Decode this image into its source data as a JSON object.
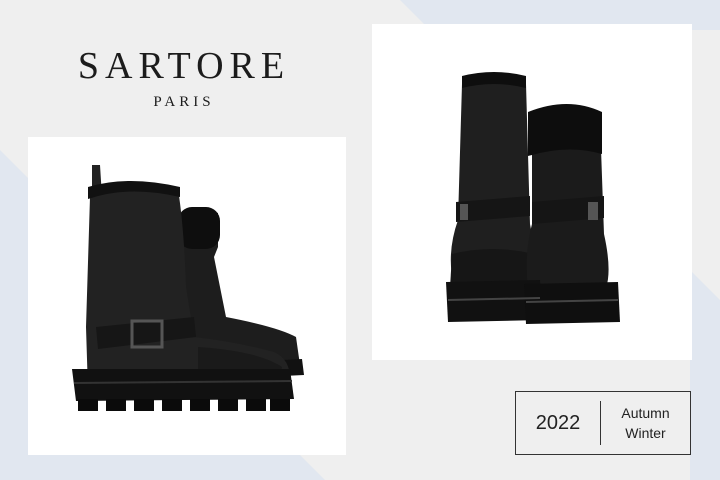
{
  "brand": {
    "name": "SARTORE",
    "city": "PARIS"
  },
  "images": [
    {
      "subject": "black leather shearling-lined buckle boot, side view"
    },
    {
      "subject": "black leather shearling-lined buckle boots, front view"
    }
  ],
  "season": {
    "year": "2022",
    "line1": "Autumn",
    "line2": "Winter"
  },
  "colors": {
    "background": "#efefef",
    "accent_blue": "#e1e7f0",
    "text": "#1c1c1c",
    "boot": "#1a1a1a"
  }
}
